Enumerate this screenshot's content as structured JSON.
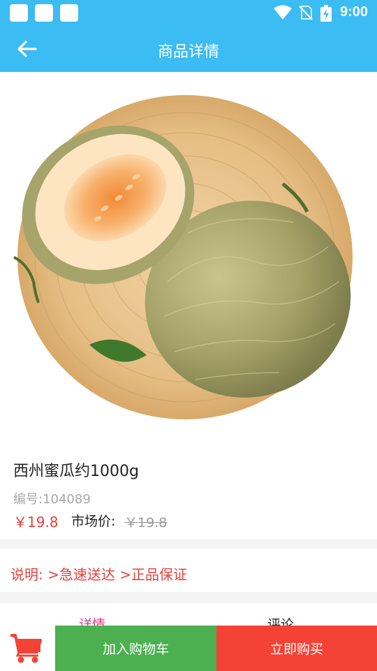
{
  "status_bar": {
    "time": "9:00",
    "icons": [
      "notification-square",
      "notification-square",
      "notification-square",
      "wifi-icon",
      "no-sim-icon",
      "battery-charging-icon"
    ]
  },
  "app_bar": {
    "title": "商品详情",
    "back_icon": "arrow-left-icon"
  },
  "product": {
    "name": "西州蜜瓜约1000g",
    "code": "编号:104089",
    "price": "￥19.8",
    "market_label": "市场价:",
    "market_price": "￥19.8"
  },
  "description": "说明: >急速送达 >正品保证",
  "tabs": [
    {
      "label": "详情",
      "active": true
    },
    {
      "label": "评论",
      "active": false
    }
  ],
  "bottom_bar": {
    "cart_icon": "shopping-cart-icon",
    "add_to_cart_label": "加入购物车",
    "buy_now_label": "立即购买"
  },
  "colors": {
    "primary": "#3bbcf3",
    "price_red": "#e8403a",
    "active_tab": "#d33a86",
    "add_cart_green": "#4cb050",
    "buy_red": "#f44336"
  }
}
